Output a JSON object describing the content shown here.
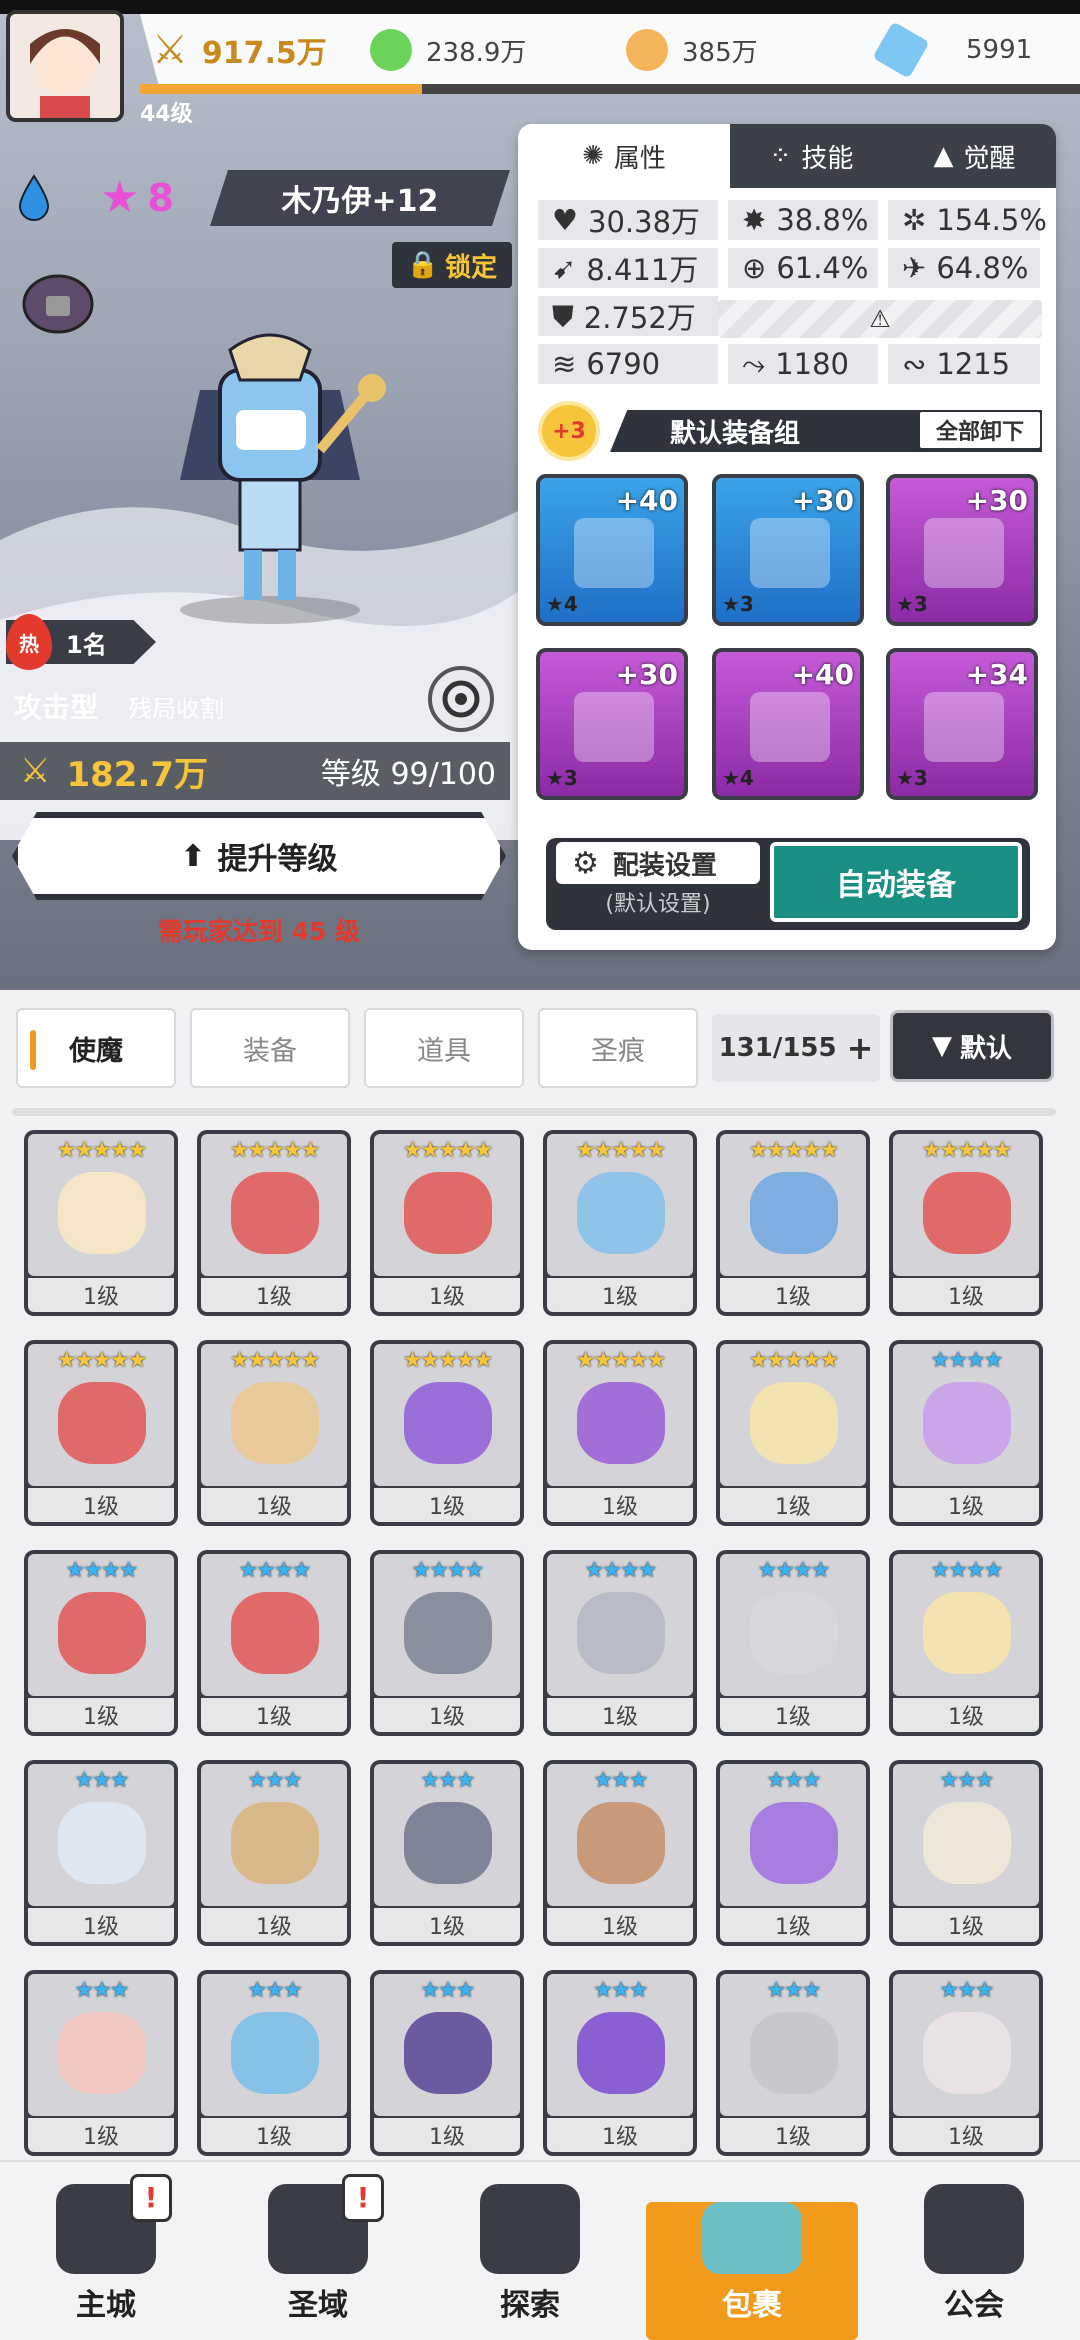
{
  "resources": {
    "power": "917.5万",
    "green": "238.9万",
    "orange": "385万",
    "gem": "5991"
  },
  "player": {
    "level": "44级",
    "exp_fraction": 0.3
  },
  "hero": {
    "element": "water",
    "stars": "8",
    "name": "木乃伊+12",
    "lock": "锁定",
    "rank_label": "热",
    "rank": "1名",
    "type": "攻击型",
    "subtype": "残局收割",
    "power": "182.7万",
    "level": "等级 99/100",
    "upgrade": "提升等级",
    "requirement": "需玩家达到 45 级"
  },
  "panel": {
    "tabs": [
      "属性",
      "技能",
      "觉醒"
    ],
    "stats": {
      "hp": "30.38万",
      "crit": "38.8%",
      "crit_dmg": "154.5%",
      "atk": "8.411万",
      "acc": "61.4%",
      "dodge": "64.8%",
      "def": "2.752万",
      "speed": "6790",
      "pen": "1180",
      "res": "1215"
    },
    "equip_plus": "+3",
    "equip_set": "默认装备组",
    "unequip": "全部卸下",
    "equipment": [
      {
        "plus": "+40",
        "rank": "★4",
        "color": "blue",
        "icon": "sword-icon"
      },
      {
        "plus": "+30",
        "rank": "★3",
        "color": "blue",
        "icon": "helmet-icon"
      },
      {
        "plus": "+30",
        "rank": "★3",
        "color": "purple",
        "icon": "armor-icon"
      },
      {
        "plus": "+30",
        "rank": "★3",
        "color": "purple",
        "icon": "belt-icon"
      },
      {
        "plus": "+40",
        "rank": "★4",
        "color": "purple",
        "icon": "necklace-icon"
      },
      {
        "plus": "+34",
        "rank": "★3",
        "color": "purple",
        "icon": "boots-icon"
      }
    ],
    "config": "配装设置",
    "config_sub": "(默认设置)",
    "auto": "自动装备"
  },
  "inventory": {
    "tabs": [
      "使魔",
      "装备",
      "道具",
      "圣痕"
    ],
    "count": "131/155",
    "sort": "默认",
    "cards": [
      {
        "stars": "★★★★★",
        "tier": "gold",
        "lv": "1级",
        "c": "#f5e6c8"
      },
      {
        "stars": "★★★★★",
        "tier": "gold",
        "lv": "1级",
        "c": "#e06a6a"
      },
      {
        "stars": "★★★★★",
        "tier": "gold",
        "lv": "1级",
        "c": "#e06a6a"
      },
      {
        "stars": "★★★★★",
        "tier": "gold",
        "lv": "1级",
        "c": "#8fc4e8"
      },
      {
        "stars": "★★★★★",
        "tier": "gold",
        "lv": "1级",
        "c": "#7eaee0"
      },
      {
        "stars": "★★★★★",
        "tier": "gold",
        "lv": "1级",
        "c": "#e06a6a"
      },
      {
        "stars": "★★★★★",
        "tier": "gold",
        "lv": "1级",
        "c": "#e06a6a"
      },
      {
        "stars": "★★★★★",
        "tier": "gold",
        "lv": "1级",
        "c": "#e8c99a"
      },
      {
        "stars": "★★★★★",
        "tier": "gold",
        "lv": "1级",
        "c": "#9b6fd9"
      },
      {
        "stars": "★★★★★",
        "tier": "gold",
        "lv": "1级",
        "c": "#a36ed8"
      },
      {
        "stars": "★★★★★",
        "tier": "gold",
        "lv": "1级",
        "c": "#f3e3b0"
      },
      {
        "stars": "★★★★",
        "tier": "blue",
        "lv": "1级",
        "c": "#c8a6e8"
      },
      {
        "stars": "★★★★",
        "tier": "blue",
        "lv": "1级",
        "c": "#e06a6a"
      },
      {
        "stars": "★★★★",
        "tier": "blue",
        "lv": "1级",
        "c": "#e06a6a"
      },
      {
        "stars": "★★★★",
        "tier": "blue",
        "lv": "1级",
        "c": "#8a8fa0"
      },
      {
        "stars": "★★★★",
        "tier": "blue",
        "lv": "1级",
        "c": "#b9bcc6"
      },
      {
        "stars": "★★★★",
        "tier": "blue",
        "lv": "1级",
        "c": "#d6d8de"
      },
      {
        "stars": "★★★★",
        "tier": "blue",
        "lv": "1级",
        "c": "#f3e3b0"
      },
      {
        "stars": "★★★",
        "tier": "blue",
        "lv": "1级",
        "c": "#dfe7f3"
      },
      {
        "stars": "★★★",
        "tier": "blue",
        "lv": "1级",
        "c": "#d9b98a"
      },
      {
        "stars": "★★★",
        "tier": "blue",
        "lv": "1级",
        "c": "#7f8496"
      },
      {
        "stars": "★★★",
        "tier": "blue",
        "lv": "1级",
        "c": "#c89a7a"
      },
      {
        "stars": "★★★",
        "tier": "blue",
        "lv": "1级",
        "c": "#a77ee0"
      },
      {
        "stars": "★★★",
        "tier": "blue",
        "lv": "1级",
        "c": "#ece7d6"
      },
      {
        "stars": "★★★",
        "tier": "blue",
        "lv": "1级",
        "c": "#f1c9c2"
      },
      {
        "stars": "★★★",
        "tier": "blue",
        "lv": "1级",
        "c": "#86c1e6"
      },
      {
        "stars": "★★★",
        "tier": "blue",
        "lv": "1级",
        "c": "#6c5aa0"
      },
      {
        "stars": "★★★",
        "tier": "blue",
        "lv": "1级",
        "c": "#8a5fd1"
      },
      {
        "stars": "★★★",
        "tier": "blue",
        "lv": "1级",
        "c": "#c8c8cc"
      },
      {
        "stars": "★★★",
        "tier": "blue",
        "lv": "1级",
        "c": "#e9e3e6"
      }
    ]
  },
  "nav": [
    {
      "label": "主城",
      "alert": "!"
    },
    {
      "label": "圣域",
      "alert": "!"
    },
    {
      "label": "探索",
      "alert": ""
    },
    {
      "label": "包裹",
      "alert": "",
      "active": true
    },
    {
      "label": "公会",
      "alert": ""
    }
  ]
}
